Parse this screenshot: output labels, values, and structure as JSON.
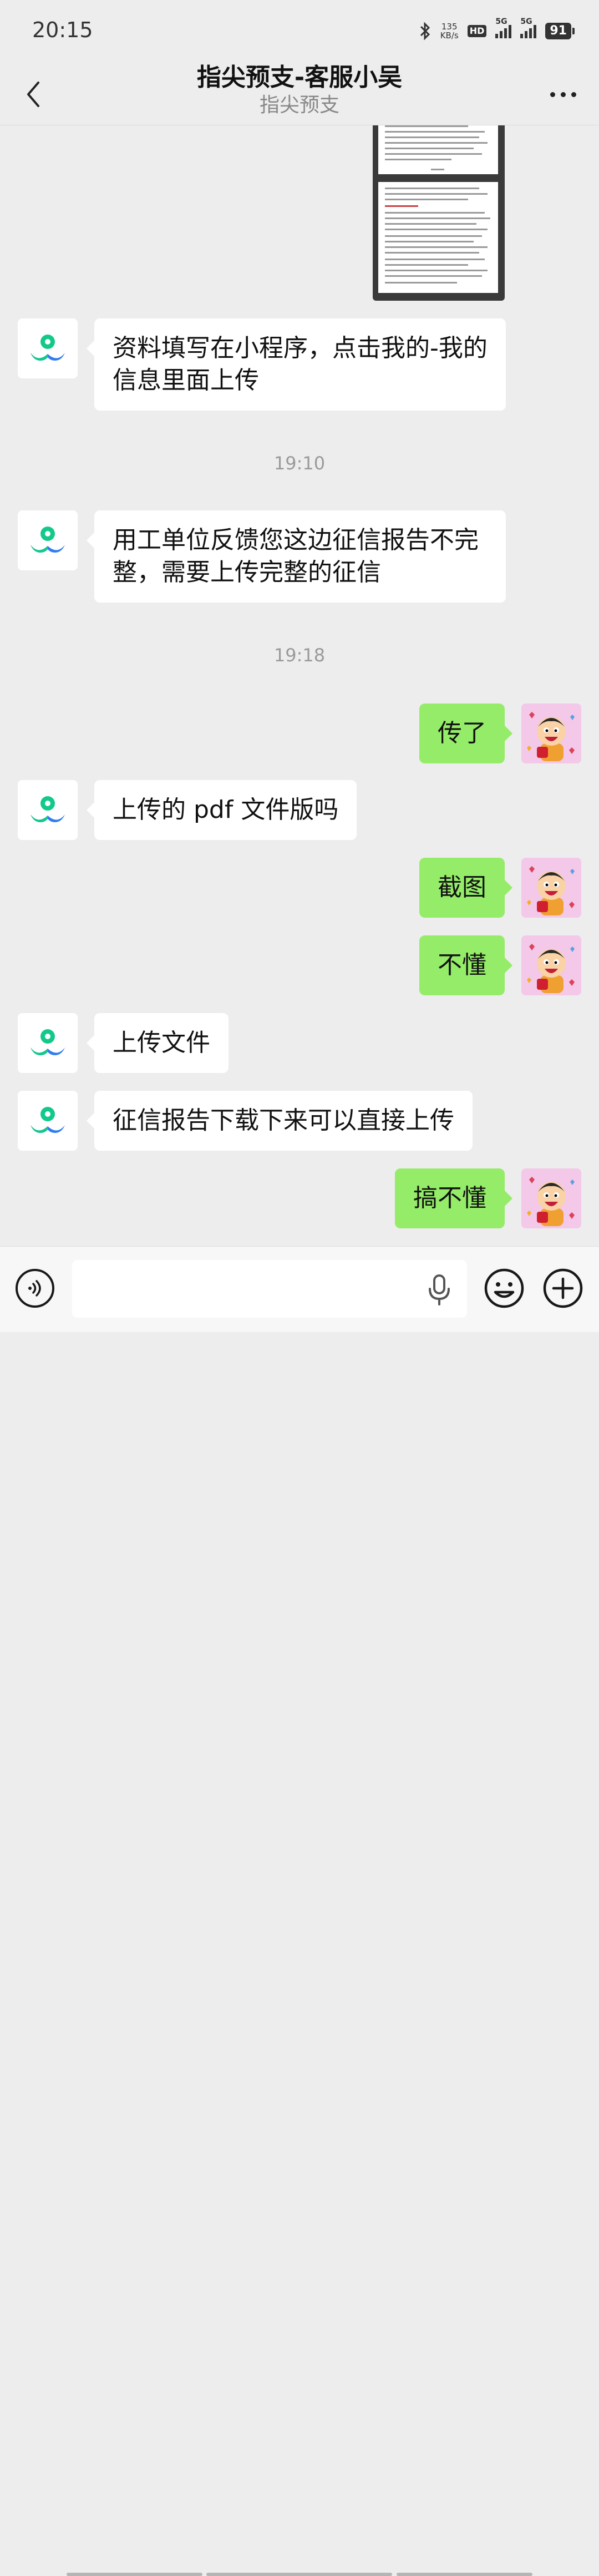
{
  "status_bar": {
    "time": "20:15",
    "net_speed_value": "135",
    "net_speed_unit": "KB/s",
    "hd_label": "HD",
    "signal1_label": "5G",
    "signal2_label": "5G",
    "battery": "91"
  },
  "header": {
    "title": "指尖预支-客服小吴",
    "subtitle": "指尖预支"
  },
  "messages": [
    {
      "sender": "agent",
      "text": "资料填写在小程序，点击我的-我的信息里面上传"
    },
    {
      "type": "time",
      "text": "19:10"
    },
    {
      "sender": "agent",
      "text": "用工单位反馈您这边征信报告不完整，需要上传完整的征信"
    },
    {
      "type": "time",
      "text": "19:18"
    },
    {
      "sender": "user",
      "text": "传了"
    },
    {
      "sender": "agent",
      "text": "上传的 pdf 文件版吗"
    },
    {
      "sender": "user",
      "text": "截图"
    },
    {
      "sender": "user",
      "text": "不懂"
    },
    {
      "sender": "agent",
      "text": "上传文件"
    },
    {
      "sender": "agent",
      "text": "征信报告下载下来可以直接上传"
    },
    {
      "sender": "user",
      "text": "搞不懂"
    }
  ],
  "input": {
    "placeholder": "",
    "icons": [
      "voice-icon",
      "mic-icon",
      "emoji-icon",
      "plus-icon"
    ]
  },
  "colors": {
    "background": "#ededed",
    "user_bubble": "#95ec69",
    "agent_bubble": "#ffffff",
    "brand_green": "#12c98a",
    "brand_blue": "#2f7df1"
  }
}
